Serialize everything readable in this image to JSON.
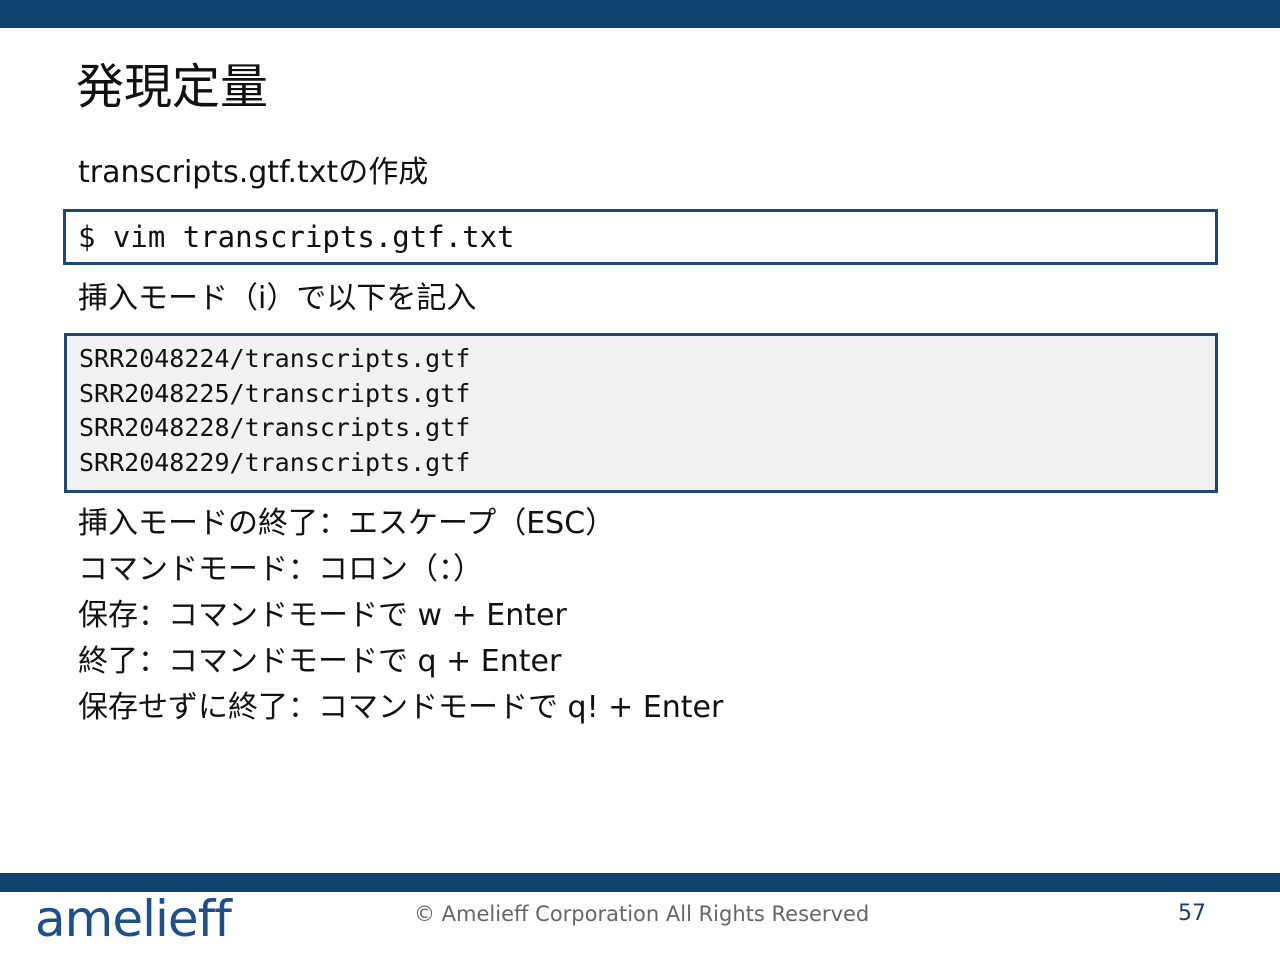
{
  "slide": {
    "title": "発現定量",
    "subtitle": "transcripts.gtf.txtの作成",
    "command": "$ vim transcripts.gtf.txt",
    "insert_instruction": "挿入モード（i）で以下を記入",
    "code_lines": [
      "SRR2048224/transcripts.gtf",
      "SRR2048225/transcripts.gtf",
      "SRR2048228/transcripts.gtf",
      "SRR2048229/transcripts.gtf"
    ],
    "notes": [
      "挿入モードの終了：エスケープ（ESC）",
      "コマンドモード：コロン（：）",
      "保存：コマンドモードで w + Enter",
      "終了：コマンドモードで q + Enter",
      "保存せずに終了：コマンドモードで q! + Enter"
    ]
  },
  "footer": {
    "logo_text": "amelieff",
    "copyright": "© Amelieff Corporation All Rights Reserved",
    "page_number": "57"
  },
  "colors": {
    "brand_bar": "#0e4370",
    "box_border": "#1d4679",
    "code_background": "#f1f1f1"
  }
}
